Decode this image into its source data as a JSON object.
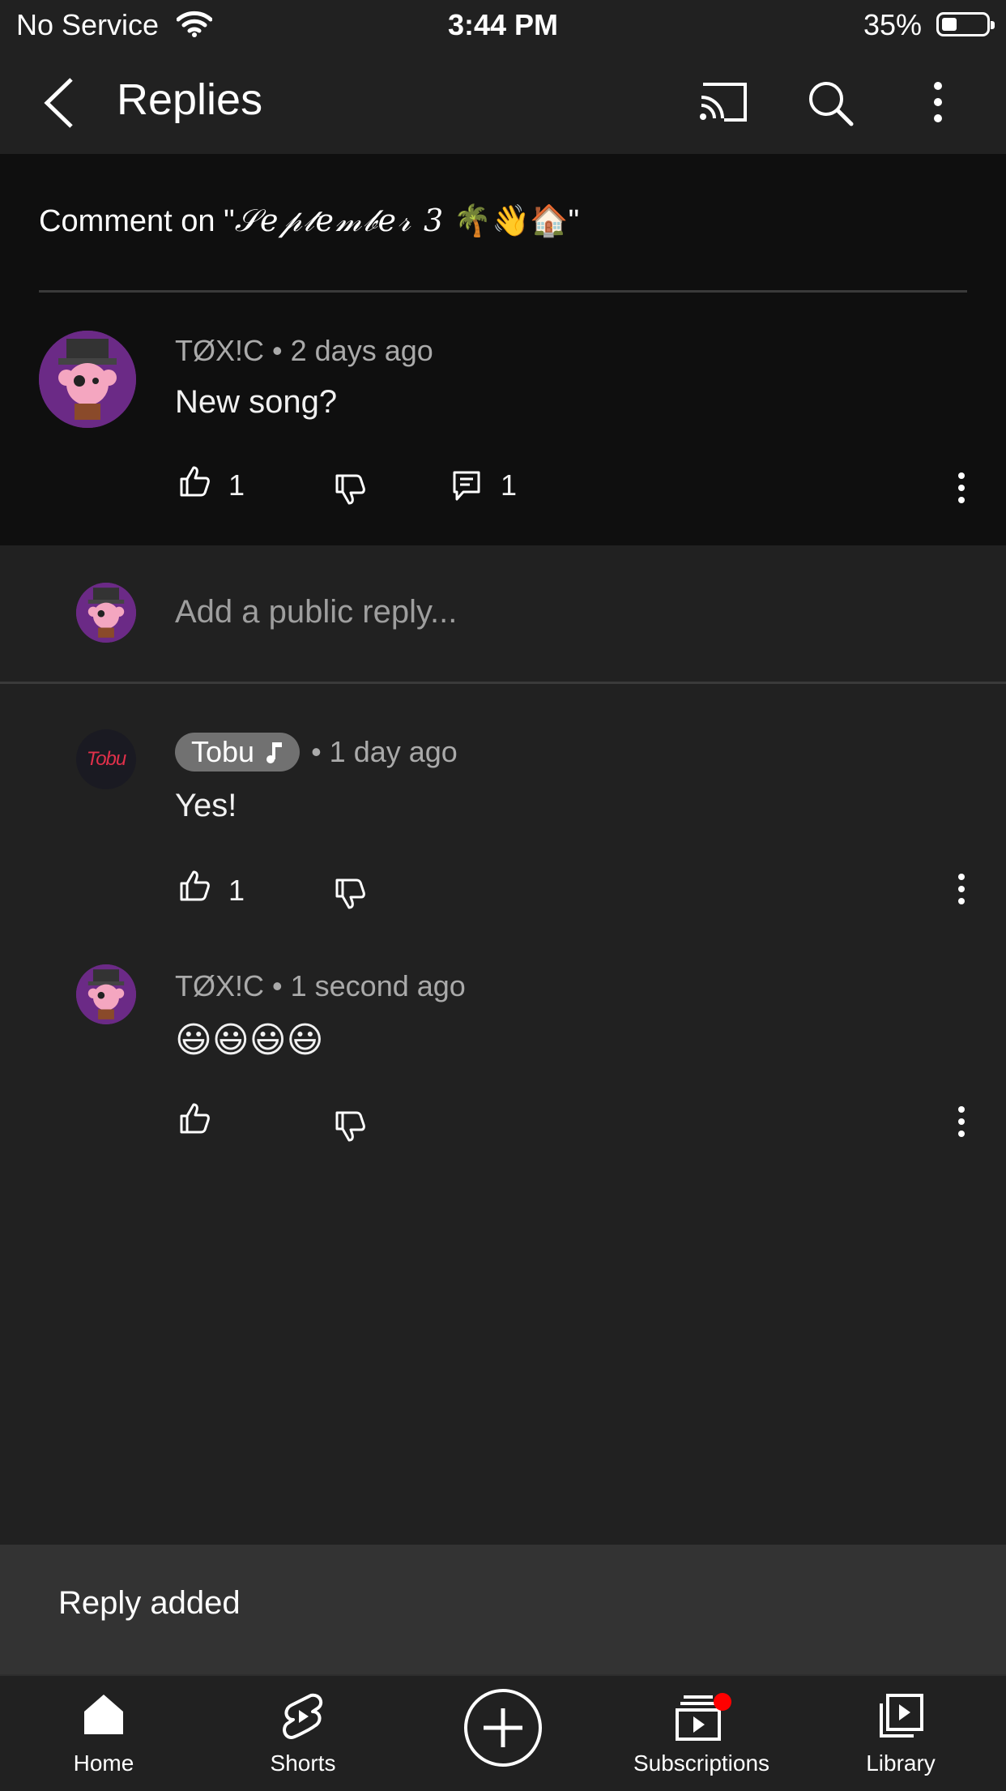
{
  "status_bar": {
    "carrier": "No Service",
    "time": "3:44 PM",
    "battery": "35%"
  },
  "header": {
    "title": "Replies"
  },
  "comment_context": {
    "prefix": "Comment on \"",
    "video_title": "𝒮𝑒𝓅𝓉𝑒𝓂𝒷𝑒𝓇 3",
    "emojis": "🌴👋🏠",
    "suffix": "\""
  },
  "original_comment": {
    "author": "TØX!C",
    "time": "• 2 days ago",
    "text": "New song?",
    "likes": "1",
    "replies": "1"
  },
  "reply_input": {
    "placeholder": "Add a public reply..."
  },
  "replies": [
    {
      "author": "Tobu",
      "avatar_text": "Tobu",
      "time": "• 1 day ago",
      "text": "Yes!",
      "likes": "1"
    },
    {
      "author": "TØX!C",
      "time": "• 1 second ago",
      "text": "😃😃😃😃",
      "likes": ""
    }
  ],
  "snackbar": {
    "message": "Reply added"
  },
  "bottom_nav": {
    "home": "Home",
    "shorts": "Shorts",
    "subscriptions": "Subscriptions",
    "library": "Library"
  },
  "colors": {
    "background": "#212121",
    "dark_panel": "#0f0f0f",
    "notification_dot": "#ff0000",
    "avatar_purple": "#6b2a86"
  },
  "icons": [
    "back-arrow-icon",
    "cast-icon",
    "search-icon",
    "more-vert-icon",
    "like-icon",
    "dislike-icon",
    "reply-icon",
    "music-note-icon",
    "home-icon",
    "shorts-icon",
    "create-icon",
    "subscriptions-icon",
    "library-icon"
  ]
}
